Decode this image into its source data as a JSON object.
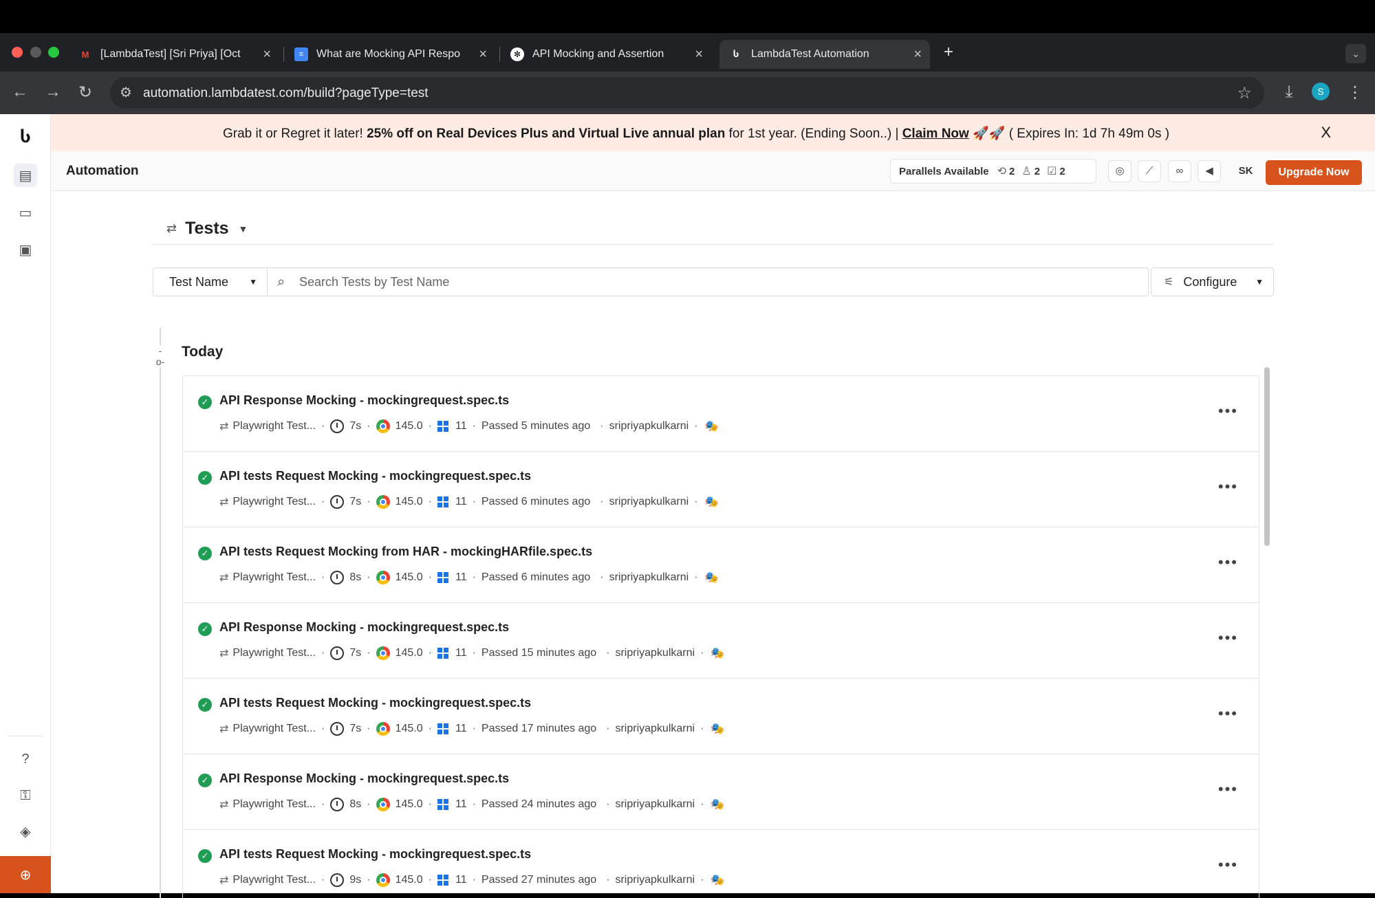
{
  "browser": {
    "tabs": [
      {
        "title": "[LambdaTest] [Sri Priya] [Oct",
        "icon": "gmail-icon"
      },
      {
        "title": "What are Mocking API Respo",
        "icon": "docs-icon"
      },
      {
        "title": "API Mocking and Assertion",
        "icon": "chatgpt-icon"
      },
      {
        "title": "LambdaTest Automation",
        "icon": "lambdatest-icon"
      }
    ],
    "url": "automation.lambdatest.com/build?pageType=test",
    "profile_initial": "S"
  },
  "banner": {
    "lead": "Grab it or Regret it later!",
    "offer": "25% off on Real Devices Plus and Virtual Live annual plan",
    "tail": "for 1st year. (Ending Soon..) |",
    "cta": "Claim Now",
    "emoji": "🚀🚀",
    "expires": "( Expires In: 1d 7h 49m 0s )",
    "close": "X"
  },
  "header": {
    "title": "Automation",
    "parallels_label": "Parallels Available",
    "parallels": [
      "2",
      "2",
      "2"
    ],
    "user_initials": "SK",
    "upgrade": "Upgrade Now"
  },
  "tests": {
    "title": "Tests",
    "filter_select": "Test Name",
    "search_placeholder": "Search Tests by Test Name",
    "configure": "Configure",
    "group": "Today",
    "rows": [
      {
        "name": "API Response Mocking - mockingrequest.spec.ts",
        "framework": "Playwright Test...",
        "duration": "7s",
        "browser_version": "145.0",
        "os_version": "11",
        "status": "Passed 5 minutes ago",
        "user": "sripriyapkulkarni"
      },
      {
        "name": "API tests Request Mocking - mockingrequest.spec.ts",
        "framework": "Playwright Test...",
        "duration": "7s",
        "browser_version": "145.0",
        "os_version": "11",
        "status": "Passed 6 minutes ago",
        "user": "sripriyapkulkarni"
      },
      {
        "name": "API tests Request Mocking from HAR - mockingHARfile.spec.ts",
        "framework": "Playwright Test...",
        "duration": "8s",
        "browser_version": "145.0",
        "os_version": "11",
        "status": "Passed 6 minutes ago",
        "user": "sripriyapkulkarni"
      },
      {
        "name": "API Response Mocking - mockingrequest.spec.ts",
        "framework": "Playwright Test...",
        "duration": "7s",
        "browser_version": "145.0",
        "os_version": "11",
        "status": "Passed 15 minutes ago",
        "user": "sripriyapkulkarni"
      },
      {
        "name": "API tests Request Mocking - mockingrequest.spec.ts",
        "framework": "Playwright Test...",
        "duration": "7s",
        "browser_version": "145.0",
        "os_version": "11",
        "status": "Passed 17 minutes ago",
        "user": "sripriyapkulkarni"
      },
      {
        "name": "API Response Mocking - mockingrequest.spec.ts",
        "framework": "Playwright Test...",
        "duration": "8s",
        "browser_version": "145.0",
        "os_version": "11",
        "status": "Passed 24 minutes ago",
        "user": "sripriyapkulkarni"
      },
      {
        "name": "API tests Request Mocking - mockingrequest.spec.ts",
        "framework": "Playwright Test...",
        "duration": "9s",
        "browser_version": "145.0",
        "os_version": "11",
        "status": "Passed 27 minutes ago",
        "user": "sripriyapkulkarni"
      }
    ]
  },
  "colors": {
    "accent": "#d8531c",
    "passed": "#1f9d55",
    "banner_bg": "#fdebe4"
  }
}
